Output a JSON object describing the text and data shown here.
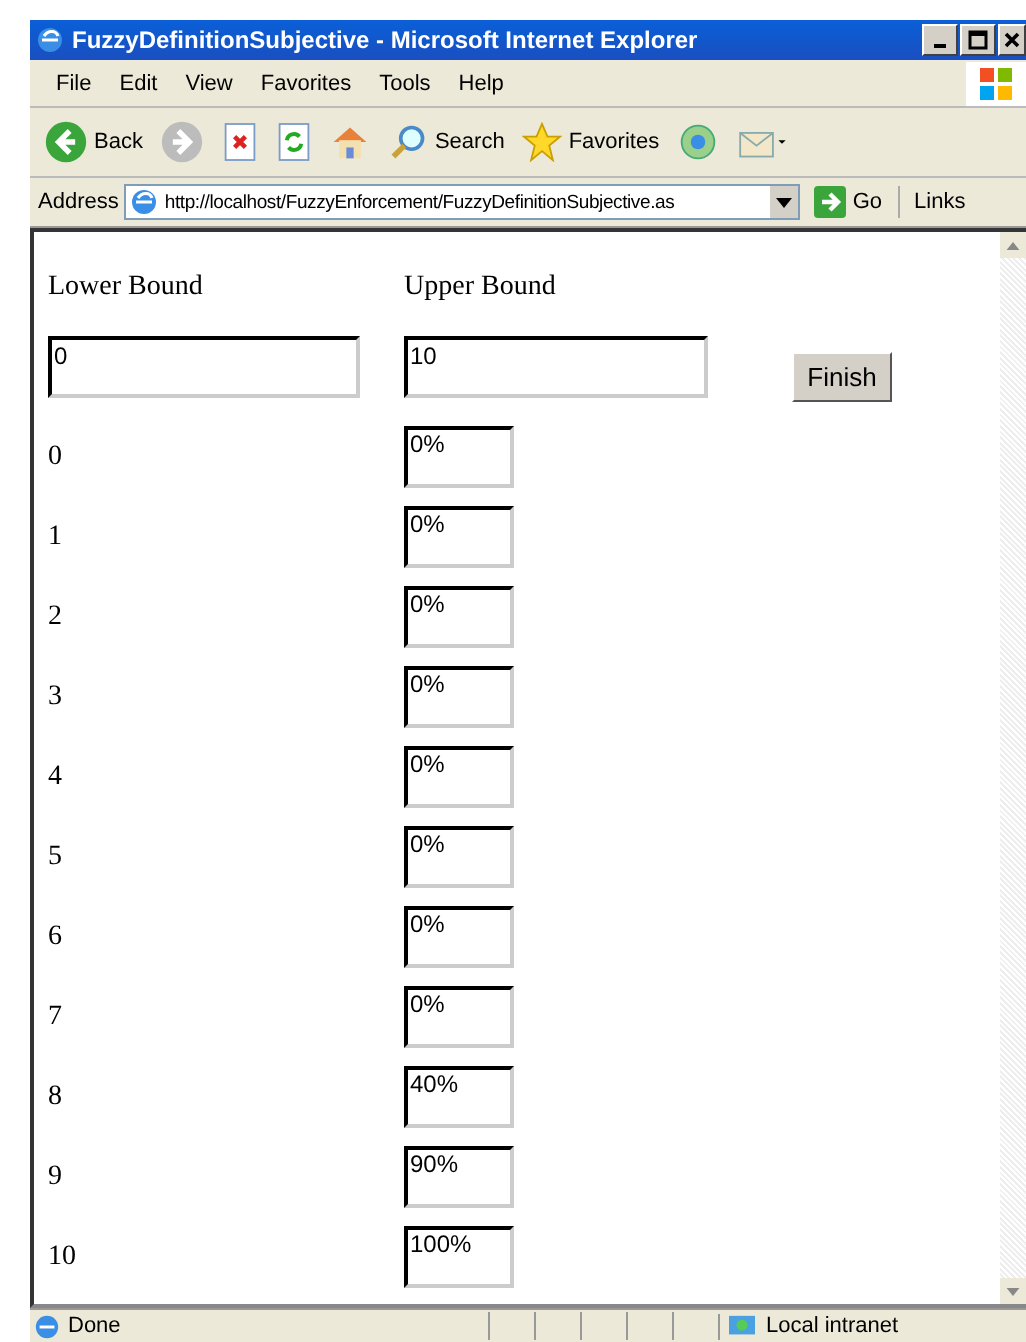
{
  "window": {
    "title": "FuzzyDefinitionSubjective - Microsoft Internet Explorer"
  },
  "menu": [
    "File",
    "Edit",
    "View",
    "Favorites",
    "Tools",
    "Help"
  ],
  "toolbar": [
    {
      "kind": "back",
      "label": "Back"
    },
    {
      "kind": "forward"
    },
    {
      "kind": "stop"
    },
    {
      "kind": "refresh"
    },
    {
      "kind": "home"
    },
    {
      "kind": "search",
      "label": "Search"
    },
    {
      "kind": "favorites",
      "label": "Favorites"
    },
    {
      "kind": "media"
    },
    {
      "kind": "mail"
    }
  ],
  "address_bar": {
    "label": "Address",
    "url": "http://localhost/FuzzyEnforcement/FuzzyDefinitionSubjective.as",
    "go": "Go",
    "links": "Links"
  },
  "form": {
    "lower_label": "Lower Bound",
    "upper_label": "Upper Bound",
    "lower_value": "0",
    "upper_value": "10",
    "finish": "Finish",
    "rows": [
      {
        "label": "0",
        "value": "0%"
      },
      {
        "label": "1",
        "value": "0%"
      },
      {
        "label": "2",
        "value": "0%"
      },
      {
        "label": "3",
        "value": "0%"
      },
      {
        "label": "4",
        "value": "0%"
      },
      {
        "label": "5",
        "value": "0%"
      },
      {
        "label": "6",
        "value": "0%"
      },
      {
        "label": "7",
        "value": "0%"
      },
      {
        "label": "8",
        "value": "40%"
      },
      {
        "label": "9",
        "value": "90%"
      },
      {
        "label": "10",
        "value": "100%"
      }
    ]
  },
  "status_bar": {
    "text": "Done",
    "zone": "Local intranet"
  }
}
